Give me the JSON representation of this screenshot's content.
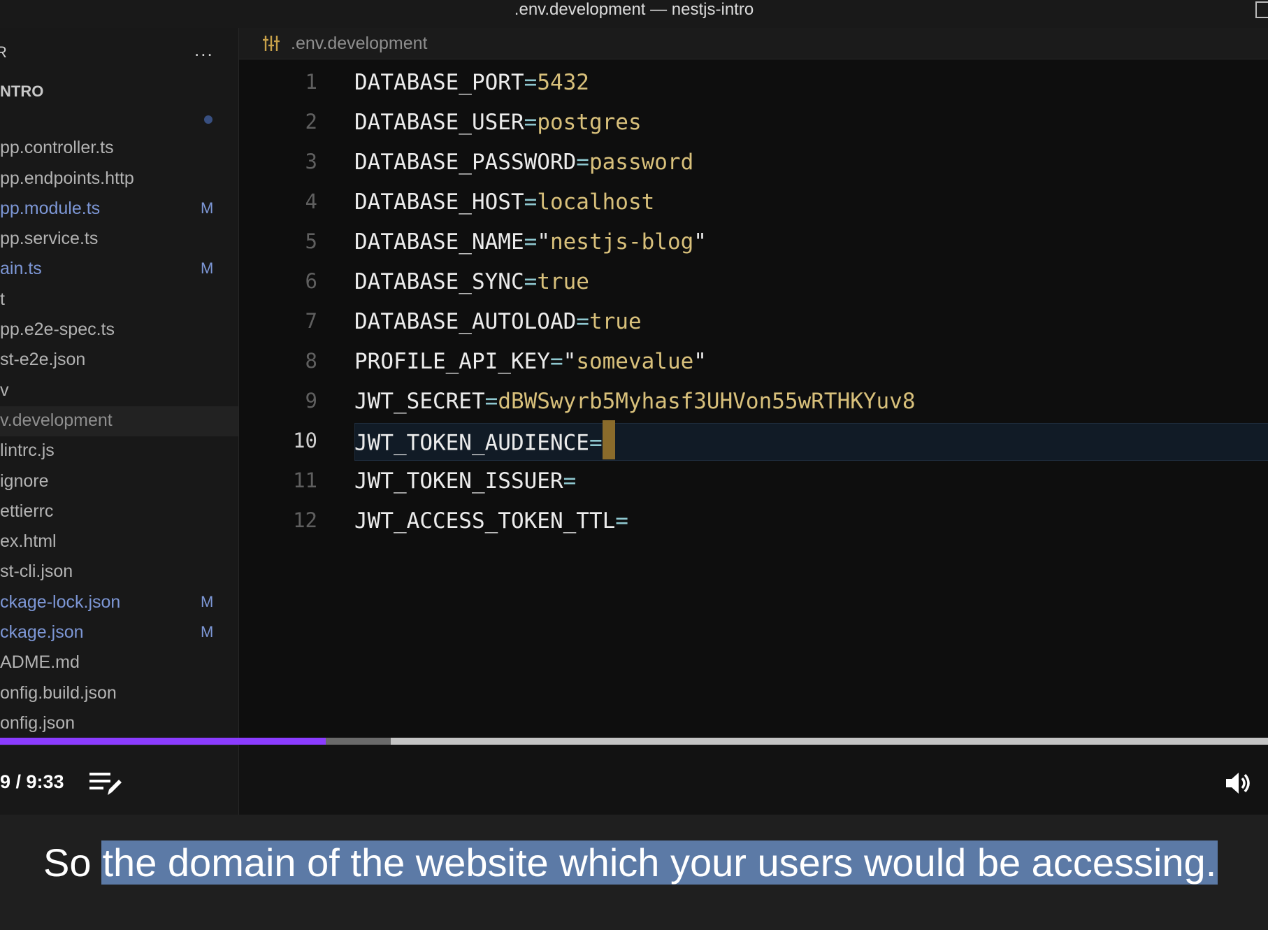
{
  "window": {
    "title": ".env.development — nestjs-intro"
  },
  "sidebar": {
    "header": "R",
    "more_label": "...",
    "folder": "NTRO",
    "files": [
      {
        "name": "",
        "dot": true
      },
      {
        "name": "pp.controller.ts",
        "badge": ""
      },
      {
        "name": "pp.endpoints.http",
        "badge": ""
      },
      {
        "name": "pp.module.ts",
        "badge": "M"
      },
      {
        "name": "pp.service.ts",
        "badge": ""
      },
      {
        "name": "ain.ts",
        "badge": "M"
      },
      {
        "name": "t",
        "badge": ""
      },
      {
        "name": "pp.e2e-spec.ts",
        "badge": ""
      },
      {
        "name": "st-e2e.json",
        "badge": ""
      },
      {
        "name": "v",
        "badge": ""
      },
      {
        "name": "v.development",
        "badge": "",
        "active": true
      },
      {
        "name": "lintrc.js",
        "badge": ""
      },
      {
        "name": "ignore",
        "badge": ""
      },
      {
        "name": "ettierrc",
        "badge": ""
      },
      {
        "name": "ex.html",
        "badge": ""
      },
      {
        "name": "st-cli.json",
        "badge": ""
      },
      {
        "name": "ckage-lock.json",
        "badge": "M"
      },
      {
        "name": "ckage.json",
        "badge": "M"
      },
      {
        "name": "ADME.md",
        "badge": ""
      },
      {
        "name": "onfig.build.json",
        "badge": ""
      },
      {
        "name": "onfig.json",
        "badge": ""
      }
    ]
  },
  "editor": {
    "tab": {
      "name": ".env.development",
      "icon": "settings-sliders-icon"
    },
    "lines": [
      {
        "num": "1",
        "key": "DATABASE_PORT",
        "eq": "=",
        "value": "5432"
      },
      {
        "num": "2",
        "key": "DATABASE_USER",
        "eq": "=",
        "value": "postgres"
      },
      {
        "num": "3",
        "key": "DATABASE_PASSWORD",
        "eq": "=",
        "value": "password"
      },
      {
        "num": "4",
        "key": "DATABASE_HOST",
        "eq": "=",
        "value": "localhost"
      },
      {
        "num": "5",
        "key": "DATABASE_NAME",
        "eq": "=",
        "value": "nestjs-blog",
        "quoted": true
      },
      {
        "num": "6",
        "key": "DATABASE_SYNC",
        "eq": "=",
        "value": "true"
      },
      {
        "num": "7",
        "key": "DATABASE_AUTOLOAD",
        "eq": "=",
        "value": "true"
      },
      {
        "num": "8",
        "key": "PROFILE_API_KEY",
        "eq": "=",
        "value": "somevalue",
        "quoted": true
      },
      {
        "num": "9",
        "key": "JWT_SECRET",
        "eq": "=",
        "value": "dBWSwyrb5Myhasf3UHVon55wRTHKYuv8"
      },
      {
        "num": "10",
        "key": "JWT_TOKEN_AUDIENCE",
        "eq": "=",
        "value": "",
        "current": true
      },
      {
        "num": "11",
        "key": "JWT_TOKEN_ISSUER",
        "eq": "=",
        "value": ""
      },
      {
        "num": "12",
        "key": "JWT_ACCESS_TOKEN_TTL",
        "eq": "=",
        "value": ""
      }
    ]
  },
  "player": {
    "time": "9 / 9:33",
    "played_fraction": 0.257,
    "buffered_fraction": 0.308,
    "notes_icon": "notes-edit-icon",
    "volume_icon": "volume-icon",
    "progress_color": "#8b3cff"
  },
  "caption": {
    "lead": "So",
    "highlight": "the domain of the website which your users would be accessing."
  }
}
